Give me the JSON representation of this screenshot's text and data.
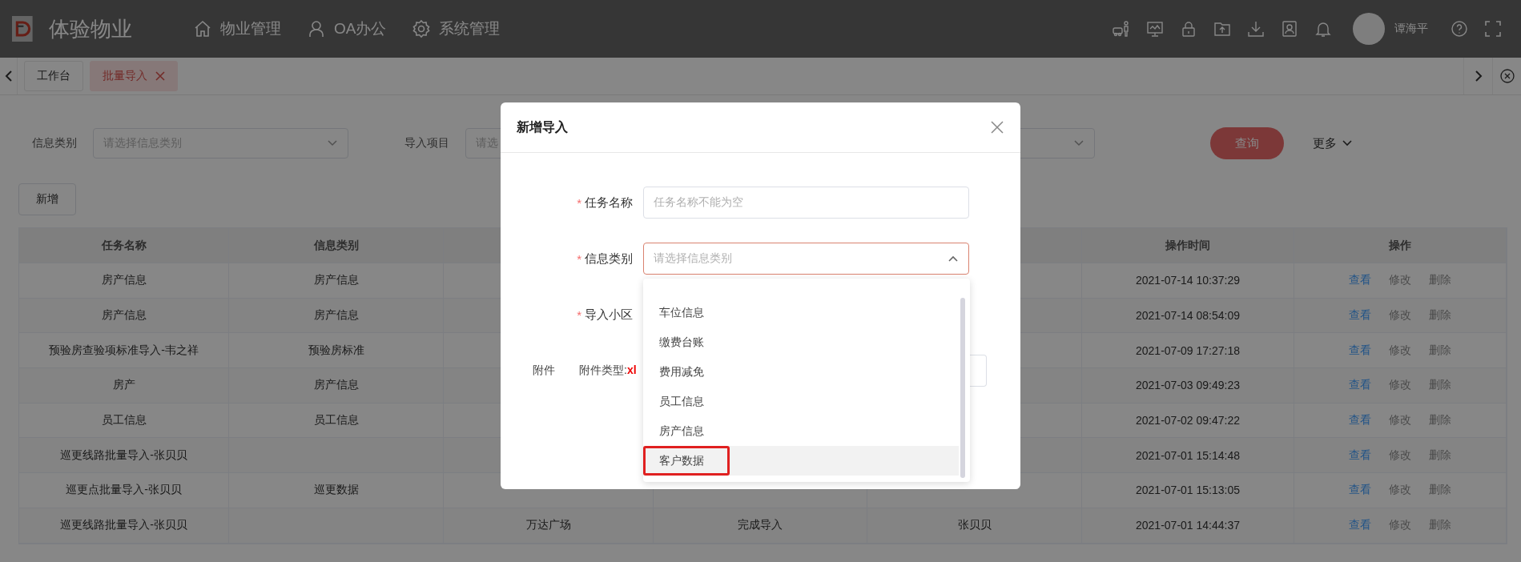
{
  "header": {
    "brand": "体验物业",
    "nav": [
      {
        "label": "物业管理",
        "kind": "house"
      },
      {
        "label": "OA办公",
        "kind": "person"
      },
      {
        "label": "系统管理",
        "kind": "gear"
      }
    ],
    "user": {
      "name": "谭海平"
    }
  },
  "tabs": [
    {
      "label": "工作台",
      "selected": false,
      "closable": false
    },
    {
      "label": "批量导入",
      "selected": true,
      "closable": true
    }
  ],
  "filters": [
    {
      "label": "信息类别",
      "placeholder": "请选择信息类别"
    },
    {
      "label": "导入项目",
      "placeholder": "请选"
    }
  ],
  "query_button": "查询",
  "more_button": "更多",
  "add_button": "新增",
  "table": {
    "columns": [
      "任务名称",
      "信息类别",
      null,
      null,
      null,
      "操作时间",
      "操作"
    ],
    "rows": [
      {
        "cells": [
          "房产信息",
          "房产信息",
          null,
          null,
          null,
          "2021-07-14 10:37:29"
        ],
        "actions": [
          {
            "label": "查看",
            "disabled": false
          },
          {
            "label": "修改",
            "disabled": true
          },
          {
            "label": "删除",
            "disabled": true
          }
        ]
      },
      {
        "cells": [
          "房产信息",
          "房产信息",
          null,
          null,
          null,
          "2021-07-14 08:54:09"
        ],
        "actions": [
          {
            "label": "查看",
            "disabled": false
          },
          {
            "label": "修改",
            "disabled": true
          },
          {
            "label": "删除",
            "disabled": true
          }
        ]
      },
      {
        "cells": [
          "预验房查验项标准导入-韦之祥",
          "预验房标准",
          null,
          null,
          null,
          "2021-07-09 17:27:18"
        ],
        "actions": [
          {
            "label": "查看",
            "disabled": false
          },
          {
            "label": "修改",
            "disabled": true
          },
          {
            "label": "删除",
            "disabled": true
          }
        ]
      },
      {
        "cells": [
          "房产",
          "房产信息",
          null,
          null,
          null,
          "2021-07-03 09:49:23"
        ],
        "actions": [
          {
            "label": "查看",
            "disabled": false
          },
          {
            "label": "修改",
            "disabled": true
          },
          {
            "label": "删除",
            "disabled": true
          }
        ]
      },
      {
        "cells": [
          "员工信息",
          "员工信息",
          null,
          null,
          null,
          "2021-07-02 09:47:22"
        ],
        "actions": [
          {
            "label": "查看",
            "disabled": false
          },
          {
            "label": "修改",
            "disabled": true
          },
          {
            "label": "删除",
            "disabled": true
          }
        ]
      },
      {
        "cells": [
          "巡更线路批量导入-张贝贝",
          null,
          null,
          null,
          null,
          "2021-07-01 15:14:48"
        ],
        "actions": [
          {
            "label": "查看",
            "disabled": false
          },
          {
            "label": "修改",
            "disabled": true
          },
          {
            "label": "删除",
            "disabled": true
          }
        ]
      },
      {
        "cells": [
          "巡更点批量导入-张贝贝",
          "巡更数据",
          null,
          null,
          null,
          "2021-07-01 15:13:05"
        ],
        "actions": [
          {
            "label": "查看",
            "disabled": false
          },
          {
            "label": "修改",
            "disabled": true
          },
          {
            "label": "删除",
            "disabled": true
          }
        ]
      },
      {
        "cells": [
          "巡更线路批量导入-张贝贝",
          null,
          "万达广场",
          "完成导入",
          "张贝贝",
          "2021-07-01 14:44:37"
        ],
        "actions": [
          {
            "label": "查看",
            "disabled": false
          },
          {
            "label": "修改",
            "disabled": true
          },
          {
            "label": "删除",
            "disabled": true
          }
        ]
      }
    ]
  },
  "modal": {
    "title": "新增导入",
    "required_mark": "*",
    "fields": [
      {
        "label": "任务名称",
        "required": true,
        "placeholder": "任务名称不能为空",
        "focused": false
      },
      {
        "label": "信息类别",
        "required": true,
        "placeholder": "请选择信息类别",
        "focused": true,
        "expanded": true
      },
      {
        "label": "导入小区",
        "required": true
      }
    ],
    "attachment": {
      "label": "附件",
      "type_label": "附件类型:",
      "type_value": "xl"
    },
    "options": [
      {
        "label": "车位信息",
        "hovered": false,
        "marked": false
      },
      {
        "label": "缴费台账",
        "hovered": false,
        "marked": false
      },
      {
        "label": "费用减免",
        "hovered": false,
        "marked": false
      },
      {
        "label": "员工信息",
        "hovered": false,
        "marked": false
      },
      {
        "label": "房产信息",
        "hovered": false,
        "marked": false
      },
      {
        "label": "客户数据",
        "hovered": true,
        "marked": true
      }
    ]
  }
}
